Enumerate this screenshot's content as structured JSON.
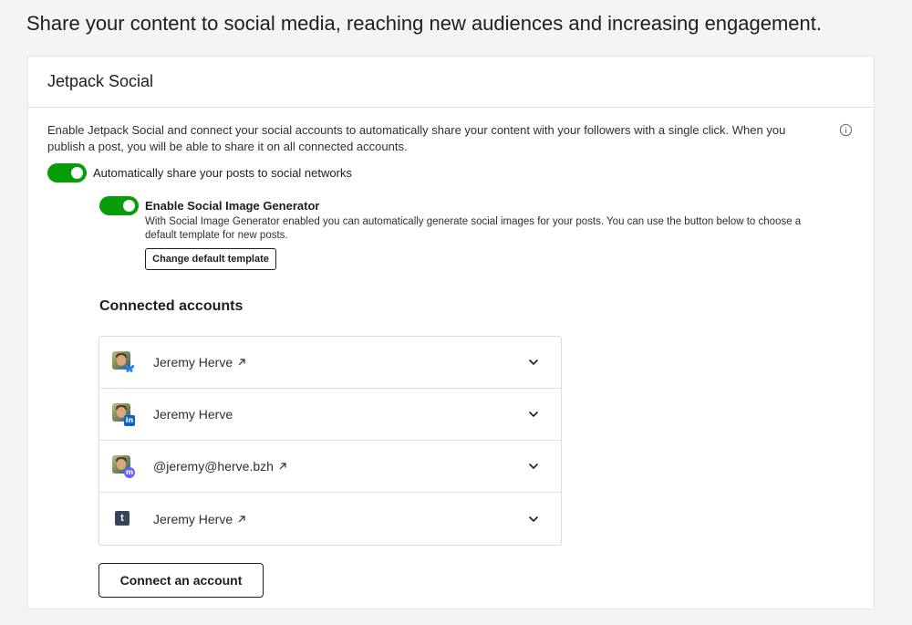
{
  "headline": "Share your content to social media, reaching new audiences and increasing engagement.",
  "card": {
    "title": "Jetpack Social",
    "description": "Enable Jetpack Social and connect your social accounts to automatically share your content with your followers with a single click. When you publish a post, you will be able to share it on all connected accounts.",
    "auto_share": {
      "label": "Automatically share your posts to social networks",
      "enabled": true
    },
    "image_generator": {
      "title": "Enable Social Image Generator",
      "enabled": true,
      "description": "With Social Image Generator enabled you can automatically generate social images for your posts. You can use the button below to choose a default template for new posts.",
      "button_label": "Change default template"
    }
  },
  "accounts": {
    "title": "Connected accounts",
    "items": [
      {
        "name": "Jeremy Herve",
        "service": "bluesky",
        "icon": "butterfly-icon",
        "external": true
      },
      {
        "name": "Jeremy Herve",
        "service": "linkedin",
        "icon": "in",
        "external": false
      },
      {
        "name": "@jeremy@herve.bzh",
        "service": "mastodon",
        "icon": "m",
        "external": true
      },
      {
        "name": "Jeremy Herve",
        "service": "tumblr",
        "icon": "t",
        "external": true
      }
    ],
    "connect_button": "Connect an account"
  },
  "colors": {
    "toggle_on": "#069e08",
    "bluesky": "#1185fe",
    "linkedin": "#0a66c2",
    "mastodon": "#6364ff",
    "tumblr": "#35465c"
  }
}
